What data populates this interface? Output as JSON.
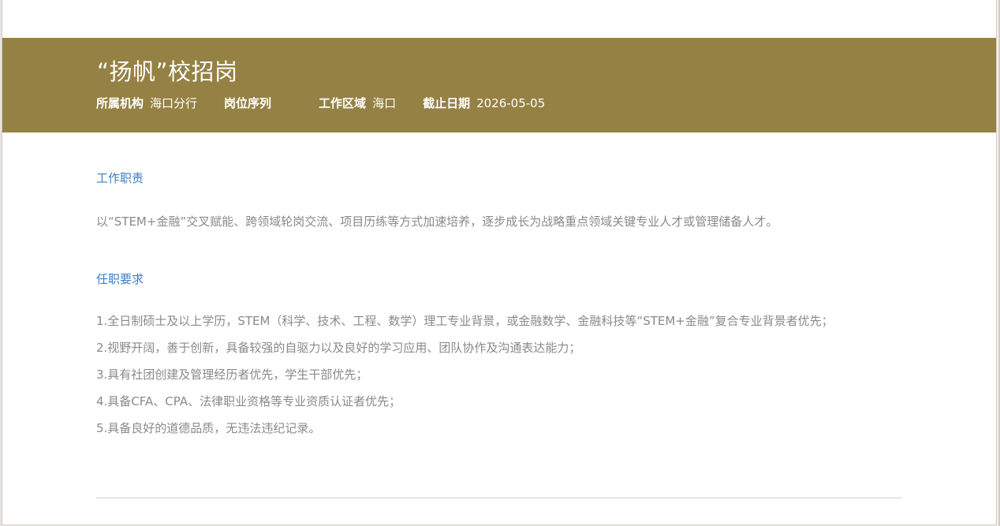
{
  "job": {
    "title": "“扬帆”校招岗",
    "meta": {
      "org_label": "所属机构",
      "org_value": "海口分行",
      "sequence_label": "岗位序列",
      "sequence_value": "",
      "region_label": "工作区域",
      "region_value": "海口",
      "deadline_label": "截止日期",
      "deadline_value": "2026-05-05"
    }
  },
  "duties": {
    "heading": "工作职责",
    "text": "以“STEM+金融”交叉赋能、跨领域轮岗交流、项目历练等方式加速培养，逐步成长为战略重点领域关键专业人才或管理储备人才。"
  },
  "requirements": {
    "heading": "任职要求",
    "items": [
      "1.全日制硕士及以上学历，STEM（科学、技术、工程、数学）理工专业背景，或金融数学、金融科技等“STEM+金融”复合专业背景者优先；",
      "2.视野开阔，善于创新，具备较强的自驱力以及良好的学习应用、团队协作及沟通表达能力；",
      "3.具有社团创建及管理经历者优先，学生干部优先；",
      "4.具备CFA、CPA、法律职业资格等专业资质认证者优先；",
      "5.具备良好的道德品质，无违法违纪记录。"
    ]
  },
  "colors": {
    "banner": "#958143",
    "heading": "#3c7fc0",
    "body_text": "#8a8a8a"
  }
}
